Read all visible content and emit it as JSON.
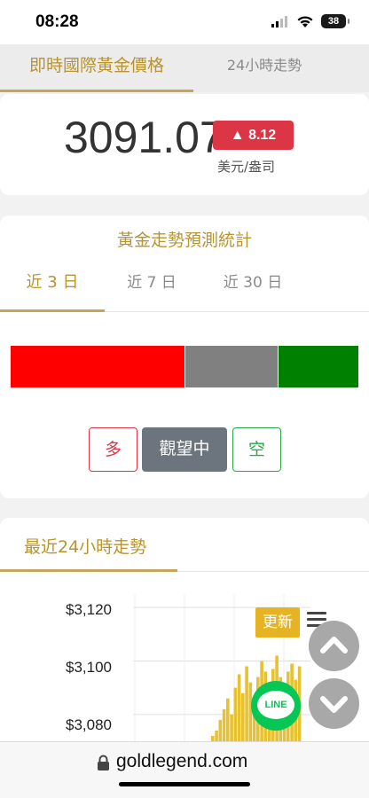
{
  "status_bar": {
    "time": "08:28",
    "battery": "38"
  },
  "top_tabs": {
    "active": "即時國際黃金價格",
    "inactive": "24小時走勢"
  },
  "price": {
    "value": "3091.07",
    "change": "▲ 8.12",
    "unit": "美元/盎司"
  },
  "forecast": {
    "title": "黃金走勢預測統計",
    "tabs": [
      "近 3 日",
      "近 7 日",
      "近 30 日"
    ],
    "bar": {
      "bullish_pct": 50,
      "neutral_pct": 27,
      "bearish_pct": 23,
      "bullish_color": "#ff0000",
      "neutral_color": "#808080",
      "bearish_color": "#008000"
    },
    "buttons": {
      "long": "多",
      "wait": "觀望中",
      "short": "空"
    }
  },
  "trend": {
    "title": "最近24小時走勢",
    "refresh": "更新",
    "line_label": "LINE",
    "icons": [
      "menu-icon",
      "scroll-up-icon",
      "scroll-down-icon",
      "line-icon",
      "lock-icon"
    ],
    "chart_data": {
      "type": "area",
      "ylim": [
        3070,
        3125
      ],
      "yticks": [
        "$3,120",
        "$3,100",
        "$3,080"
      ],
      "grid": true,
      "color": "#e6c233",
      "values": [
        3072,
        3074,
        3078,
        3082,
        3086,
        3080,
        3090,
        3095,
        3088,
        3098,
        3092,
        3085,
        3094,
        3100,
        3096,
        3089,
        3097,
        3102,
        3094,
        3088,
        3096,
        3099,
        3093,
        3098
      ]
    }
  },
  "url_bar": {
    "domain": "goldlegend.com"
  }
}
